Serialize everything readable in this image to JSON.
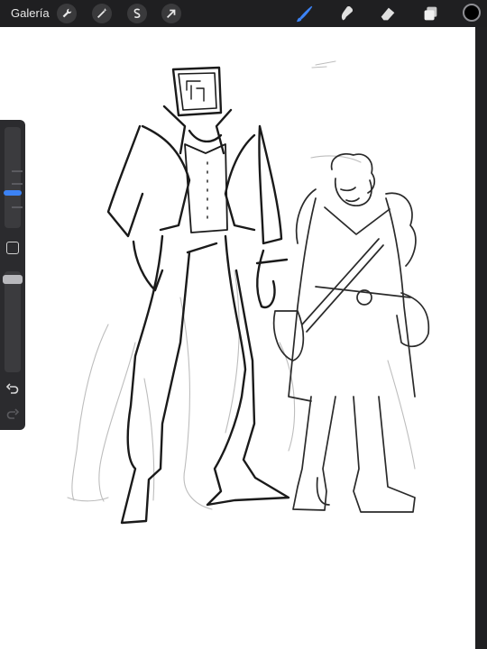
{
  "toolbar": {
    "gallery_label": "Galería",
    "left_tools": [
      {
        "name": "wrench-icon"
      },
      {
        "name": "magic-wand-icon"
      },
      {
        "name": "selection-s-icon"
      },
      {
        "name": "transform-arrow-icon"
      }
    ],
    "right_tools": [
      {
        "name": "brush-icon",
        "active": true
      },
      {
        "name": "smudge-icon"
      },
      {
        "name": "eraser-icon"
      },
      {
        "name": "layers-icon"
      }
    ],
    "current_color": "#000000"
  },
  "colors": {
    "accent": "#3c83f6",
    "toolbar_bg": "#1f1f21",
    "canvas_bg": "#ffffff"
  },
  "sidebar": {
    "brush_size_slider": "brush-size-slider",
    "modify_button": "modify-square-icon",
    "opacity_slider": "opacity-slider",
    "undo": "undo-icon",
    "redo": "redo-icon"
  }
}
